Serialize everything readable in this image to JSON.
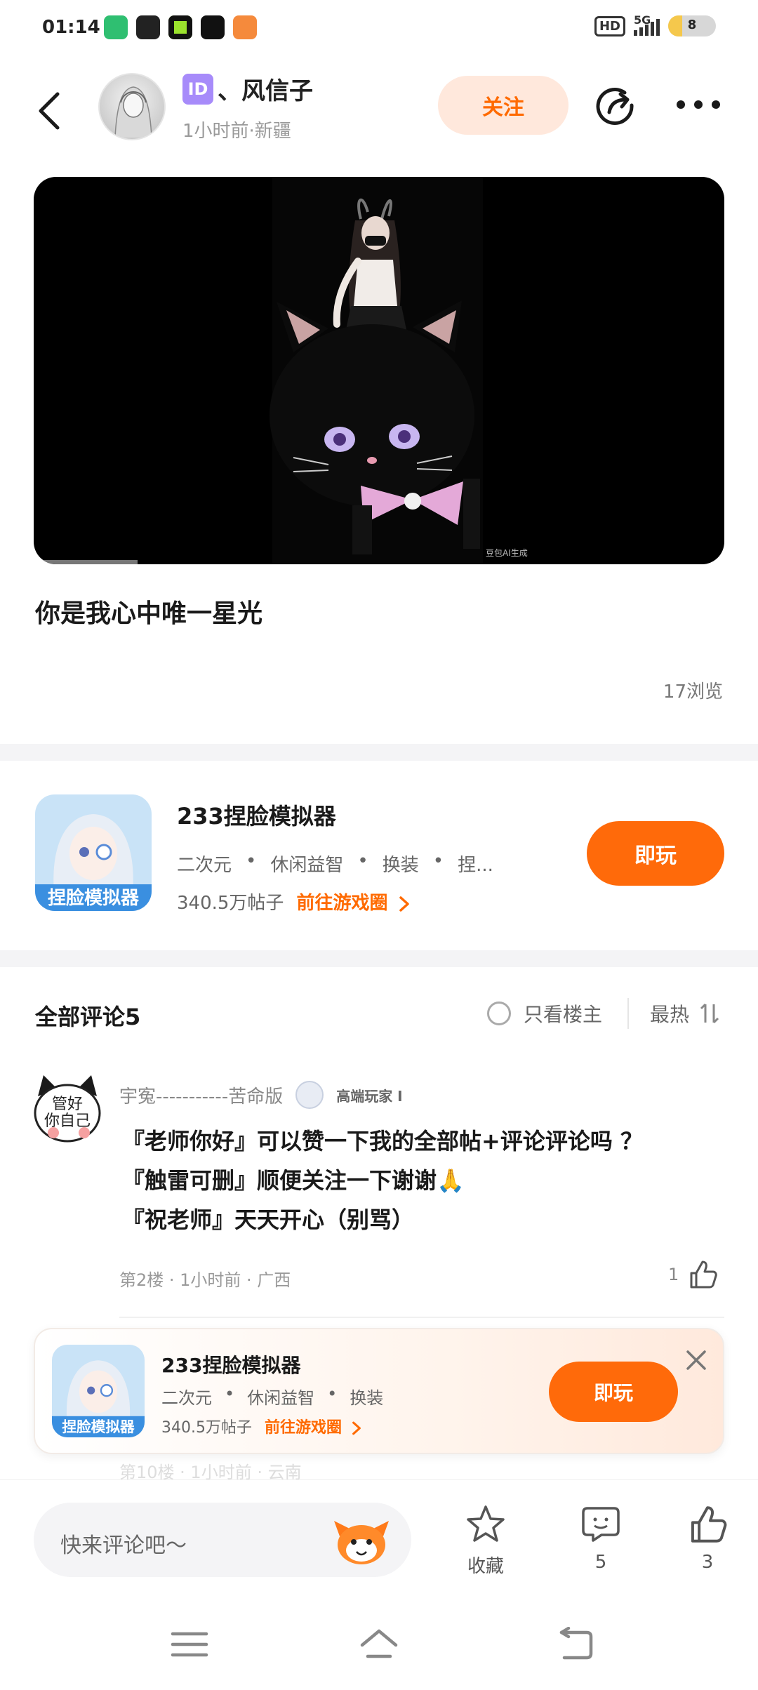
{
  "status_bar": {
    "time": "01:14",
    "hd": "HD",
    "network": "5G",
    "battery": "8"
  },
  "header": {
    "username_badge": "ID",
    "username": "、风信子",
    "meta": "1小时前·新疆",
    "follow_label": "关注"
  },
  "video": {
    "watermark": "豆包AI生成",
    "progress_fraction": 0.15
  },
  "post": {
    "title": "你是我心中唯一星光",
    "views": "17浏览"
  },
  "game": {
    "title": "233捏脸模拟器",
    "tags": [
      "二次元",
      "•",
      "休闲益智",
      "•",
      "换装",
      "•",
      "捏..."
    ],
    "posts": "340.5万帖子",
    "link": "前往游戏圈",
    "play_label": "即玩"
  },
  "comments": {
    "title": "全部评论5",
    "only_op": "只看楼主",
    "sort": "最热",
    "items": [
      {
        "name": "宇寃-----------苦命版",
        "badge": "高端玩家 I",
        "lines": [
          "『老师你好』可以赞一下我的全部帖+评论评论吗 ？",
          "『触雷可删』顺便关注一下谢谢🙏",
          "『祝老师』天天开心（别骂）"
        ],
        "meta": "第2楼 · 1小时前 · 广西",
        "likes": "1"
      }
    ],
    "faded_meta": "第10楼 · 1小时前 · 云南"
  },
  "floating_game": {
    "title": "233捏脸模拟器",
    "tags": [
      "二次元",
      "•",
      "休闲益智",
      "•",
      "换装"
    ],
    "posts": "340.5万帖子",
    "link": "前往游戏圈",
    "play_label": "即玩"
  },
  "bottom_bar": {
    "placeholder": "快来评论吧～",
    "favorite_label": "收藏",
    "comment_count": "5",
    "like_count": "3"
  },
  "colors": {
    "accent": "#ff6a0a",
    "follow_bg": "#ffe8dc"
  }
}
